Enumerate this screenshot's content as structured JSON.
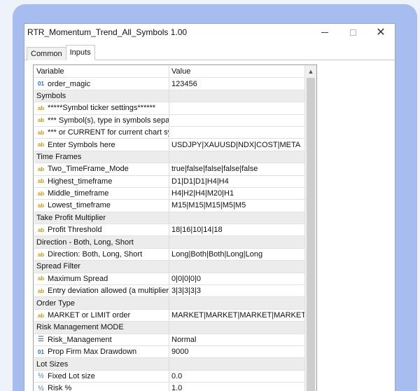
{
  "window": {
    "title": "RTR_Momentum_Trend_All_Symbols 1.00",
    "minimize_glyph": "—",
    "close_glyph": "✕"
  },
  "tabs": [
    {
      "label": "Common",
      "active": false
    },
    {
      "label": "Inputs",
      "active": true
    }
  ],
  "grid": {
    "headers": {
      "name": "Variable",
      "value": "Value"
    },
    "rows": [
      {
        "kind": "param",
        "icon": "01",
        "name": "order_magic",
        "value": "123456"
      },
      {
        "kind": "section",
        "name": "Symbols"
      },
      {
        "kind": "param",
        "icon": "ab",
        "name": "*****Symbol ticker settings******",
        "value": ""
      },
      {
        "kind": "param",
        "icon": "ab",
        "name": "*** Symbol(s), type in symbols separa...",
        "value": ""
      },
      {
        "kind": "param",
        "icon": "ab",
        "name": "*** or CURRENT for current chart sy...",
        "value": ""
      },
      {
        "kind": "param",
        "icon": "ab",
        "name": "Enter Symbols here",
        "value": "USDJPY|XAUUSD|NDX|COST|META"
      },
      {
        "kind": "section",
        "name": "Time Frames"
      },
      {
        "kind": "param",
        "icon": "ab",
        "name": "Two_TimeFrame_Mode",
        "value": "true|false|false|false|false"
      },
      {
        "kind": "param",
        "icon": "ab",
        "name": "Highest_timeframe",
        "value": "D1|D1|D1|H4|H4"
      },
      {
        "kind": "param",
        "icon": "ab",
        "name": "Middle_timeframe",
        "value": "H4|H2|H4|M20|H1"
      },
      {
        "kind": "param",
        "icon": "ab",
        "name": "Lowest_timeframe",
        "value": "M15|M15|M15|M5|M5"
      },
      {
        "kind": "section",
        "name": "Take Profit Multiplier"
      },
      {
        "kind": "param",
        "icon": "ab",
        "name": "Profit Threshold",
        "value": "18|16|10|14|18"
      },
      {
        "kind": "section",
        "name": "Direction - Both, Long, Short"
      },
      {
        "kind": "param",
        "icon": "ab",
        "name": "Direction: Both, Long, Short",
        "value": "Long|Both|Both|Long|Long"
      },
      {
        "kind": "section",
        "name": "Spread Filter"
      },
      {
        "kind": "param",
        "icon": "ab",
        "name": "Maximum Spread",
        "value": "0|0|0|0|0"
      },
      {
        "kind": "param",
        "icon": "ab",
        "name": "Entry deviation allowed (a multiplier of...",
        "value": "3|3|3|3|3"
      },
      {
        "kind": "section",
        "name": "Order Type"
      },
      {
        "kind": "param",
        "icon": "ab",
        "name": "MARKET or LIMIT order",
        "value": "MARKET|MARKET|MARKET|MARKET|MAR..."
      },
      {
        "kind": "section",
        "name": "Risk Management MODE"
      },
      {
        "kind": "param",
        "icon": "enum",
        "name": "Risk_Management",
        "value": "Normal"
      },
      {
        "kind": "param",
        "icon": "01",
        "name": "Prop Firm Max Drawdown",
        "value": "9000"
      },
      {
        "kind": "section",
        "name": "Lot Sizes"
      },
      {
        "kind": "param",
        "icon": "half",
        "name": "Fixed Lot size",
        "value": "0.0"
      },
      {
        "kind": "param",
        "icon": "half",
        "name": "Risk %",
        "value": "1.0"
      }
    ]
  },
  "icons": {
    "ab": "ab",
    "01": "01",
    "half": "½",
    "enum": "☰"
  },
  "scrollbar": {
    "up_glyph": "▲"
  }
}
